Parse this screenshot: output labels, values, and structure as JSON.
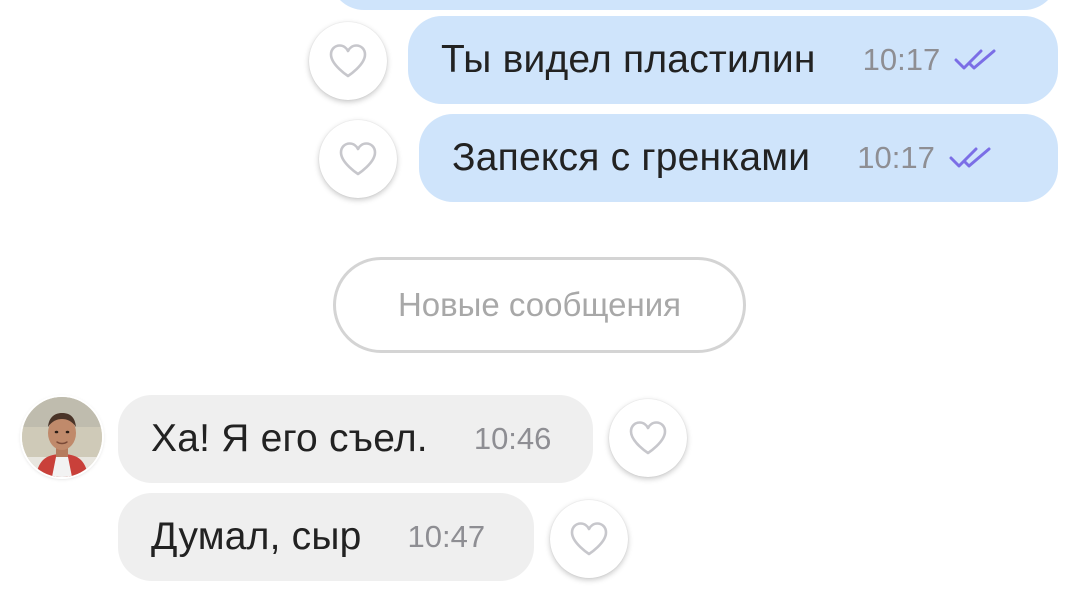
{
  "chat": {
    "outgoing": [
      {
        "text": "Ты видел пластилин",
        "time": "10:17",
        "status": "read"
      },
      {
        "text": "Запекся с гренками",
        "time": "10:17",
        "status": "read"
      }
    ],
    "divider_label": "Новые сообщения",
    "incoming": [
      {
        "text": "Ха! Я его съел.",
        "time": "10:46"
      },
      {
        "text": "Думал, сыр",
        "time": "10:47"
      }
    ]
  },
  "colors": {
    "outgoing_bubble": "#cfe4fb",
    "incoming_bubble": "#efefef",
    "read_check": "#7b6ee6",
    "time_text": "#8e8e93",
    "divider_text": "#a8a8a8"
  },
  "icons": {
    "like": "heart-outline-icon",
    "read_status": "double-check-icon"
  }
}
